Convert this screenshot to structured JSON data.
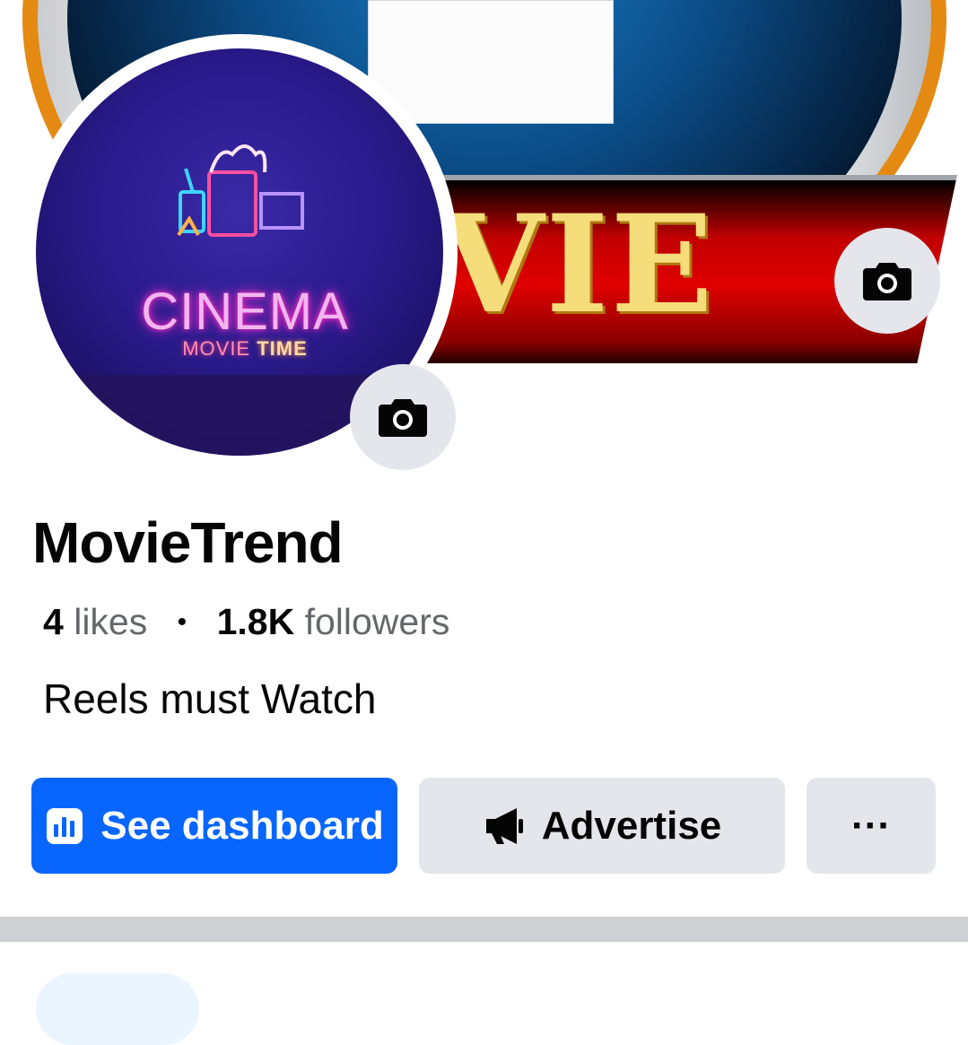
{
  "cover": {
    "title": "VIE"
  },
  "profile_photo": {
    "main_text": "CINEMA",
    "sub_text_a": "MOVIE",
    "sub_text_b": "TIME"
  },
  "page": {
    "name": "MovieTrend",
    "likes_count": "4",
    "likes_label": "likes",
    "separator": "•",
    "followers_count": "1.8K",
    "followers_label": "followers",
    "bio": "Reels must Watch"
  },
  "actions": {
    "dashboard_label": "See dashboard",
    "advertise_label": "Advertise",
    "more_label": "···"
  },
  "icons": {
    "avatar_camera": "camera-icon",
    "cover_camera": "camera-icon",
    "dashboard": "bar-chart-icon",
    "advertise": "megaphone-icon"
  },
  "colors": {
    "primary": "#0866ff",
    "secondary_button": "#e4e6eb",
    "text": "#050505",
    "muted_text": "#65676b",
    "divider": "#ced0d4"
  }
}
